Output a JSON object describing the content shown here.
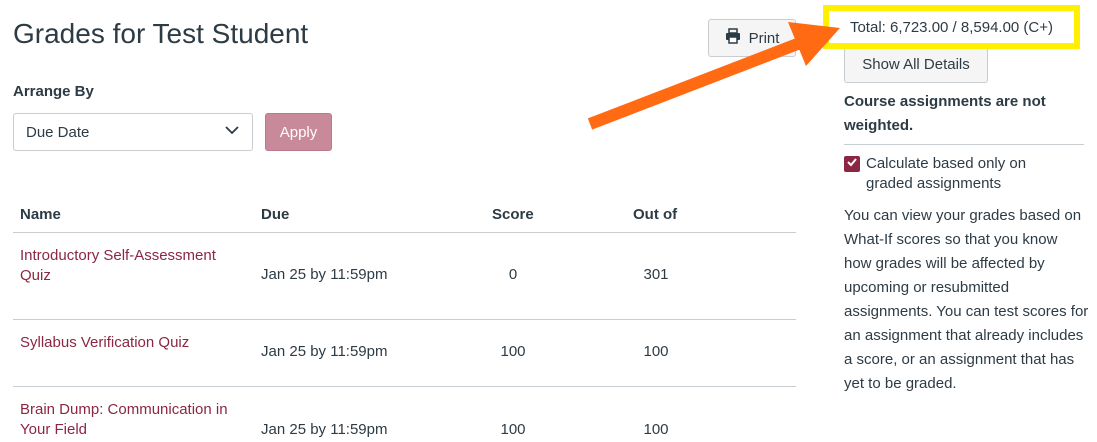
{
  "page": {
    "title": "Grades for Test Student"
  },
  "toolbar": {
    "print_label": "Print"
  },
  "arrange": {
    "label": "Arrange By",
    "selected": "Due Date",
    "apply_label": "Apply"
  },
  "table": {
    "headers": {
      "name": "Name",
      "due": "Due",
      "score": "Score",
      "out_of": "Out of"
    },
    "rows": [
      {
        "name": "Introductory Self-Assessment Quiz",
        "due": "Jan 25 by 11:59pm",
        "score": "0",
        "out_of": "301"
      },
      {
        "name": "Syllabus Verification Quiz",
        "due": "Jan 25 by 11:59pm",
        "score": "100",
        "out_of": "100"
      },
      {
        "name": "Brain Dump: Communication in Your Field",
        "due": "Jan 25 by 11:59pm",
        "score": "100",
        "out_of": "100"
      }
    ]
  },
  "sidebar": {
    "total": "Total: 6,723.00 / 8,594.00 (C+)",
    "show_details_label": "Show All Details",
    "weighted_note": "Course assignments are not weighted.",
    "calc_checkbox_label": "Calculate based only on graded assignments",
    "calc_checked": true,
    "whatif_text": "You can view your grades based on What-If scores so that you know how grades will be affected by upcoming or resubmitted assignments. You can test scores for an assignment that already includes a score, or an assignment that has yet to be graded."
  },
  "colors": {
    "accent": "#8b2742",
    "highlight": "#ffef00",
    "arrow": "#ff6a13"
  },
  "icons": {
    "print": "printer-icon",
    "dropdown": "chevron-down-icon",
    "checkbox": "checkmark-icon"
  }
}
